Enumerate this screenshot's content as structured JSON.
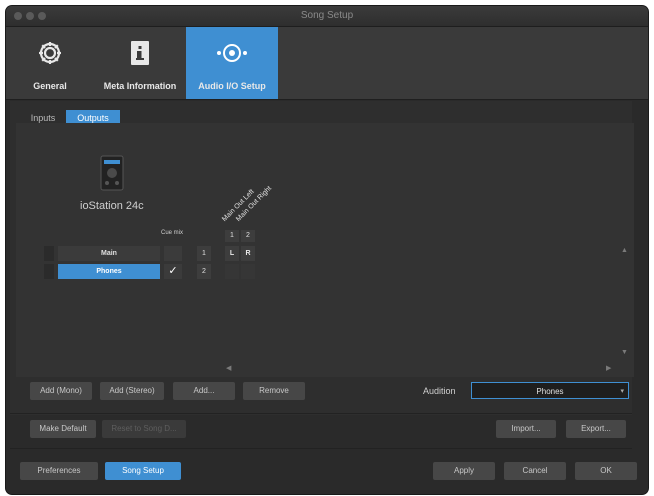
{
  "window": {
    "title": "Song Setup"
  },
  "top_tabs": [
    {
      "label": "General",
      "icon": "gear-icon",
      "active": false
    },
    {
      "label": "Meta Information",
      "icon": "info-icon",
      "active": false
    },
    {
      "label": "Audio I/O Setup",
      "icon": "audio-io-icon",
      "active": true
    }
  ],
  "sub_tabs": [
    {
      "label": "Inputs",
      "active": false
    },
    {
      "label": "Outputs",
      "active": true
    }
  ],
  "device": {
    "name": "ioStation 24c",
    "icon": "audio-interface-icon"
  },
  "routing": {
    "cue_mix_label": "Cue mix",
    "columns": [
      {
        "index": "1",
        "name": "Main Out Left"
      },
      {
        "index": "2",
        "name": "Main Out Right"
      }
    ],
    "buses": [
      {
        "name": "Main",
        "cue_mix": "",
        "row_number": "1",
        "cells": [
          "L",
          "R"
        ],
        "selected": false
      },
      {
        "name": "Phones",
        "cue_mix": "✓",
        "row_number": "2",
        "cells": [
          "",
          ""
        ],
        "selected": true
      }
    ]
  },
  "buttons": {
    "add_mono": "Add (Mono)",
    "add_stereo": "Add (Stereo)",
    "add": "Add...",
    "remove": "Remove",
    "make_default": "Make Default",
    "disabled_action": "Reset to Song D...",
    "import": "Import...",
    "export": "Export...",
    "preferences": "Preferences",
    "song_setup": "Song Setup",
    "apply": "Apply",
    "cancel": "Cancel",
    "ok": "OK"
  },
  "audition": {
    "label": "Audition",
    "value": "Phones"
  },
  "colors": {
    "accent": "#3f8fd2",
    "background": "#2a2a2a"
  }
}
